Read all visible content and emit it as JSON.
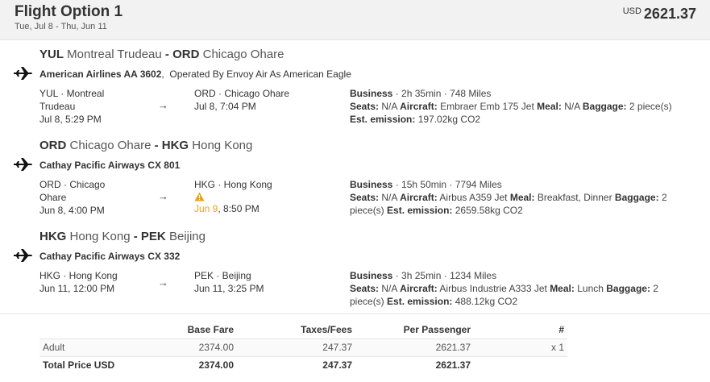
{
  "header": {
    "title": "Flight Option 1",
    "dates": "Tue, Jul 8 - Thu, Jun 11",
    "currency": "USD",
    "total": "2621.37"
  },
  "segments": [
    {
      "from_code": "YUL",
      "from_name": "Montreal Trudeau",
      "to_code": "ORD",
      "to_name": "Chicago Ohare",
      "carrier": "American Airlines AA 3602",
      "operated": "Operated By Envoy Air As American Eagle",
      "dep_city": "YUL · Montreal Trudeau",
      "dep_time": "Jul 8, 5:29 PM",
      "arr_city": "ORD · Chicago Ohare",
      "arr_time": "Jul 8, 7:04 PM",
      "cabin": "Business",
      "duration_miles": "· 2h 35min · 748 Miles",
      "seats": "N/A",
      "aircraft": "Embraer Emb 175 Jet",
      "meal": "N/A",
      "baggage": "2 piece(s)",
      "emission": "197.02kg CO2"
    },
    {
      "from_code": "ORD",
      "from_name": "Chicago Ohare",
      "to_code": "HKG",
      "to_name": "Hong Kong",
      "carrier": "Cathay Pacific Airways CX 801",
      "dep_city": "ORD · Chicago Ohare",
      "dep_time": "Jun 8, 4:00 PM",
      "arr_city": "HKG · Hong Kong",
      "arr_date": "Jun 9",
      "arr_time_rest": ", 8:50 PM",
      "cabin": "Business",
      "duration_miles": "· 15h 50min · 7794 Miles",
      "seats": "N/A",
      "aircraft": "Airbus A359 Jet",
      "meal": "Breakfast, Dinner",
      "baggage": "2 piece(s)",
      "emission": "2659.58kg CO2"
    },
    {
      "from_code": "HKG",
      "from_name": "Hong Kong",
      "to_code": "PEK",
      "to_name": "Beijing",
      "carrier": "Cathay Pacific Airways CX 332",
      "dep_city": "HKG · Hong Kong",
      "dep_time": "Jun 11, 12:00 PM",
      "arr_city": "PEK · Beijing",
      "arr_time": "Jun 11, 3:25 PM",
      "cabin": "Business",
      "duration_miles": "· 3h 25min · 1234 Miles",
      "seats": "N/A",
      "aircraft": "Airbus Industrie A333 Jet",
      "meal": "Lunch",
      "baggage": "2 piece(s)",
      "emission": "488.12kg CO2"
    }
  ],
  "labels": {
    "seats": "Seats:",
    "aircraft": "Aircraft:",
    "meal": "Meal:",
    "baggage": "Baggage:",
    "emission": "Est. emission:",
    "dash": "-",
    "arrow": "→"
  },
  "pricing": {
    "headers": [
      "",
      "Base Fare",
      "Taxes/Fees",
      "Per Passenger",
      "#"
    ],
    "adult": {
      "label": "Adult",
      "base": "2374.00",
      "taxes": "247.37",
      "per": "2621.37",
      "count": "x 1"
    },
    "total": {
      "label": "Total Price USD",
      "base": "2374.00",
      "taxes": "247.37",
      "per": "2621.37",
      "count": ""
    }
  },
  "colors": {
    "warning": "#e8a317",
    "header_bg": "#f2f2f2"
  },
  "icons": {
    "plane": "airplane-icon",
    "warning": "warning-icon",
    "arrow": "right-arrow-icon"
  }
}
